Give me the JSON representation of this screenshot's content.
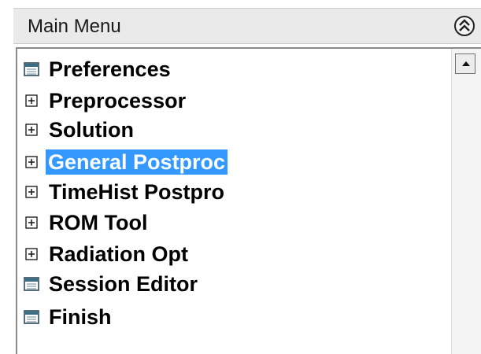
{
  "header": {
    "title": "Main Menu",
    "collapse_icon": "double-chevron-up-icon"
  },
  "tree": {
    "items": [
      {
        "label": "Preferences",
        "icon": "leaf-node-icon",
        "selected": false
      },
      {
        "label": "Preprocessor",
        "icon": "expand-plus-icon",
        "selected": false
      },
      {
        "label": "Solution",
        "icon": "expand-plus-icon",
        "selected": false
      },
      {
        "label": "General Postproc",
        "icon": "expand-plus-icon",
        "selected": true
      },
      {
        "label": "TimeHist Postpro",
        "icon": "expand-plus-icon",
        "selected": false
      },
      {
        "label": "ROM Tool",
        "icon": "expand-plus-icon",
        "selected": false
      },
      {
        "label": "Radiation Opt",
        "icon": "expand-plus-icon",
        "selected": false
      },
      {
        "label": "Session Editor",
        "icon": "leaf-node-icon",
        "selected": false
      },
      {
        "label": "Finish",
        "icon": "leaf-node-icon",
        "selected": false
      }
    ]
  },
  "colors": {
    "selection": "#3399ff",
    "header_bg": "#eaeaea"
  }
}
